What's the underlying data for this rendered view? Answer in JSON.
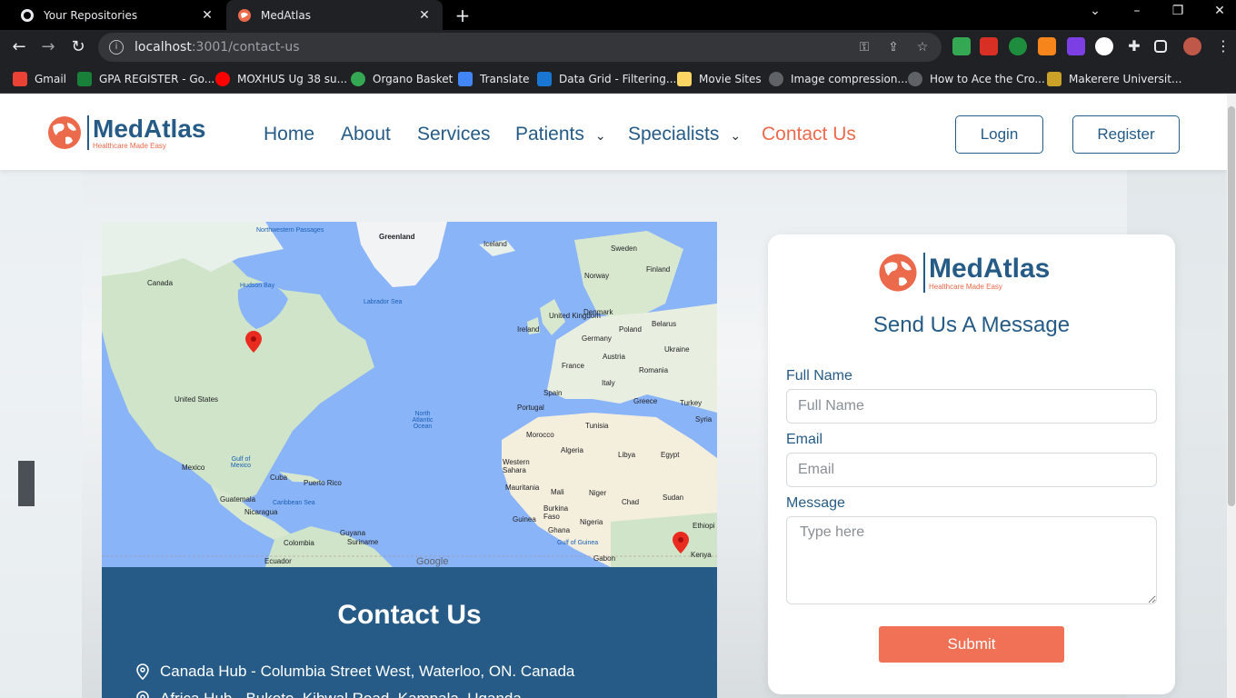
{
  "browser": {
    "tabs": [
      {
        "title": "Your Repositories",
        "icon": "github-icon"
      },
      {
        "title": "MedAtlas",
        "icon": "medatlas-favicon"
      }
    ],
    "url_host": "localhost",
    "url_path": ":3001/contact-us",
    "bookmarks": [
      {
        "label": "Gmail",
        "color": "#ea4335"
      },
      {
        "label": "GPA REGISTER - Go...",
        "color": "#188038"
      },
      {
        "label": "MOXHUS Ug 38 su...",
        "color": "#ff0000"
      },
      {
        "label": "Organo Basket",
        "color": "#34a853"
      },
      {
        "label": "Translate",
        "color": "#4285f4"
      },
      {
        "label": "Data Grid - Filtering...",
        "color": "#1976d2"
      },
      {
        "label": "Movie Sites",
        "color": "#fdd663"
      },
      {
        "label": "Image compression...",
        "color": "#5f6368"
      },
      {
        "label": "How to Ace the Cro...",
        "color": "#5f6368"
      },
      {
        "label": "Makerere Universit...",
        "color": "#c9a227"
      }
    ]
  },
  "site": {
    "brand": "MedAtlas",
    "tagline": "Healthcare Made Easy",
    "nav": {
      "home": "Home",
      "about": "About",
      "services": "Services",
      "patients": "Patients",
      "specialists": "Specialists",
      "contact": "Contact Us"
    },
    "login": "Login",
    "register": "Register",
    "colors": {
      "primary": "#255b86",
      "accent": "#ec6a4c"
    }
  },
  "map": {
    "labels": {
      "greenland": "Greenland",
      "iceland": "Iceland",
      "sweden": "Sweden",
      "finland": "Finland",
      "norway": "Norway",
      "canada": "Canada",
      "hudson": "Hudson Bay",
      "labrador": "Labrador Sea",
      "nwpassages": "Northwestern Passages",
      "uk": "United Kingdom",
      "ireland": "Ireland",
      "denmark": "Denmark",
      "belarus": "Belarus",
      "poland": "Poland",
      "germany": "Germany",
      "ukraine": "Ukraine",
      "france": "France",
      "austria": "Austria",
      "romania": "Romania",
      "italy": "Italy",
      "spain": "Spain",
      "portugal": "Portugal",
      "greece": "Greece",
      "turkey": "Turkey",
      "syria": "Syria",
      "tunisia": "Tunisia",
      "morocco": "Morocco",
      "algeria": "Algeria",
      "libya": "Libya",
      "egypt": "Egypt",
      "us": "United States",
      "mexico": "Mexico",
      "cuba": "Cuba",
      "puertorico": "Puerto Rico",
      "guatemala": "Guatemala",
      "nicaragua": "Nicaragua",
      "caribbean": "Caribbean Sea",
      "gulfmexico": "Gulf of Mexico",
      "atlantic": "North Atlantic Ocean",
      "wsahara": "Western Sahara",
      "mauritania": "Mauritania",
      "mali": "Mali",
      "niger": "Niger",
      "chad": "Chad",
      "sudan": "Sudan",
      "burkina": "Burkina Faso",
      "guinea": "Guinea",
      "ghana": "Ghana",
      "nigeria": "Nigeria",
      "ethiopia": "Ethiopi",
      "kenya": "Kenya",
      "gabon": "Gabon",
      "gulfguinea": "Gulf of Guinea",
      "guyana": "Guyana",
      "suriname": "Suriname",
      "colombia": "Colombia",
      "ecuador": "Ecuador",
      "google": "Google"
    }
  },
  "contact": {
    "title": "Contact Us",
    "line1": "Canada Hub - Columbia Street West, Waterloo, ON. Canada",
    "line2": "Africa Hub - Bukoto, Kibwal Road, Kampala, Uganda"
  },
  "form": {
    "title": "Send Us A Message",
    "fullname_label": "Full Name",
    "fullname_placeholder": "Full Name",
    "email_label": "Email",
    "email_placeholder": "Email",
    "message_label": "Message",
    "message_placeholder": "Type here",
    "submit": "Submit"
  }
}
